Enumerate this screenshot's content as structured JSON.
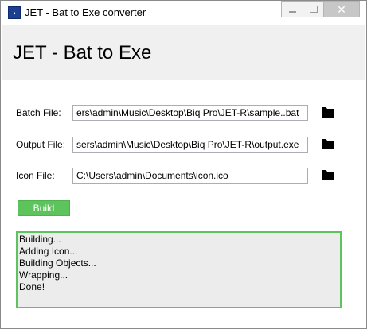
{
  "window": {
    "title": "JET - Bat to Exe converter",
    "close_glyph": "✕"
  },
  "header": {
    "title": "JET - Bat to Exe"
  },
  "form": {
    "batch": {
      "label": "Batch File:",
      "value": "ers\\admin\\Music\\Desktop\\Biq Pro\\JET-R\\sample..bat",
      "icon": "folder-icon"
    },
    "output": {
      "label": "Output File:",
      "value": "sers\\admin\\Music\\Desktop\\Biq Pro\\JET-R\\output.exe",
      "icon": "folder-icon"
    },
    "icon": {
      "label": "Icon File:",
      "value": "C:\\Users\\admin\\Documents\\icon.ico",
      "icon": "folder-icon"
    }
  },
  "build_label": "Build",
  "log": {
    "lines": [
      "Building...",
      "Adding Icon...",
      "Building Objects...",
      "Wrapping...",
      "Done!"
    ]
  },
  "colors": {
    "accent_green": "#5dc35d",
    "header_bg": "#f0f0f0",
    "log_bg": "#ececec"
  }
}
